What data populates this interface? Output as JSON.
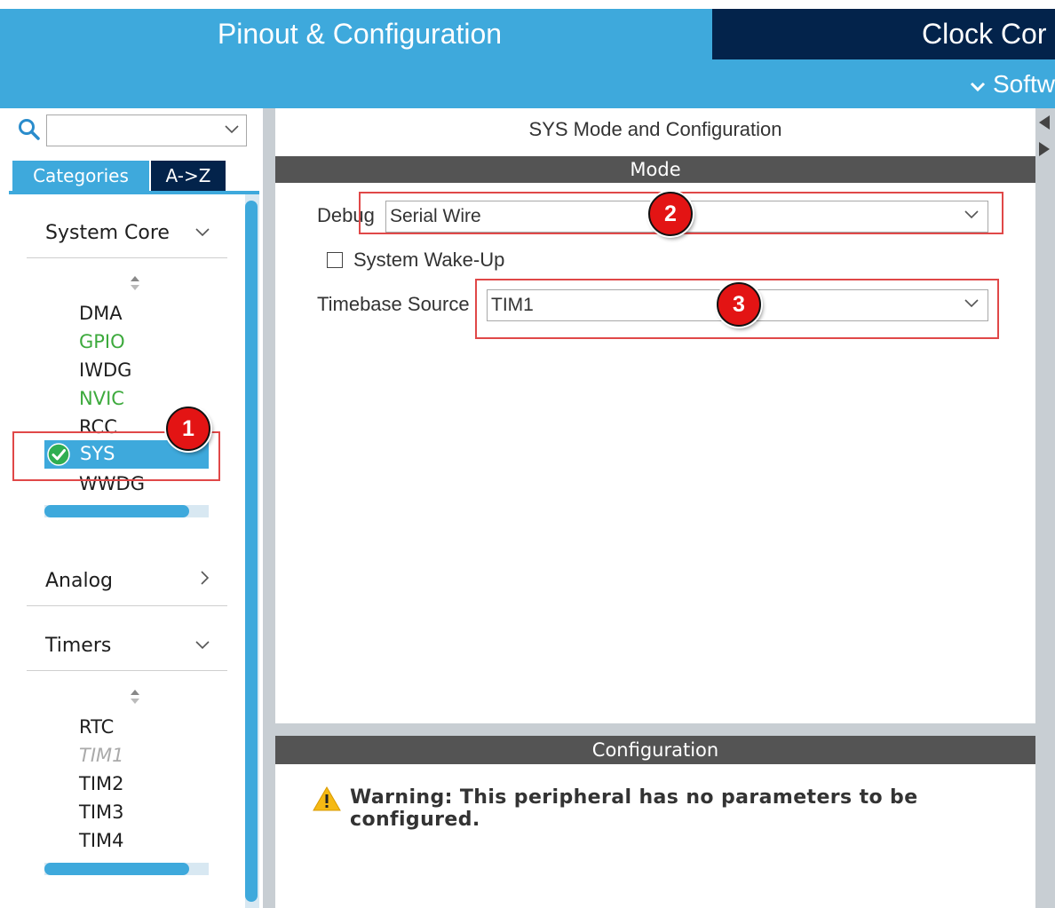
{
  "tabs": {
    "pinout": "Pinout & Configuration",
    "clock": "Clock Cor"
  },
  "subbar": {
    "software": "Softw"
  },
  "left_panel": {
    "tab_categories": "Categories",
    "tab_az": "A->Z",
    "groups": {
      "system_core": {
        "label": "System Core",
        "items": [
          "DMA",
          "GPIO",
          "IWDG",
          "NVIC",
          "RCC",
          "SYS",
          "WWDG"
        ],
        "selected": "SYS"
      },
      "analog": {
        "label": "Analog"
      },
      "timers": {
        "label": "Timers",
        "items": [
          "RTC",
          "TIM1",
          "TIM2",
          "TIM3",
          "TIM4"
        ]
      }
    }
  },
  "main": {
    "title": "SYS Mode and Configuration",
    "mode_header": "Mode",
    "debug": {
      "label": "Debug",
      "value": "Serial Wire"
    },
    "wakeup": {
      "label": "System Wake-Up",
      "checked": false
    },
    "timebase": {
      "label": "Timebase Source",
      "value": "TIM1"
    },
    "config_header": "Configuration",
    "warning": "Warning: This peripheral has no parameters to be configured."
  },
  "annotations": {
    "badge1": "1",
    "badge2": "2",
    "badge3": "3"
  },
  "colors": {
    "accent": "#3ea9dc",
    "dark_navy": "#03234b",
    "header_gray": "#545454",
    "annotation_red": "#e31414",
    "enabled_green": "#3daa3d"
  }
}
